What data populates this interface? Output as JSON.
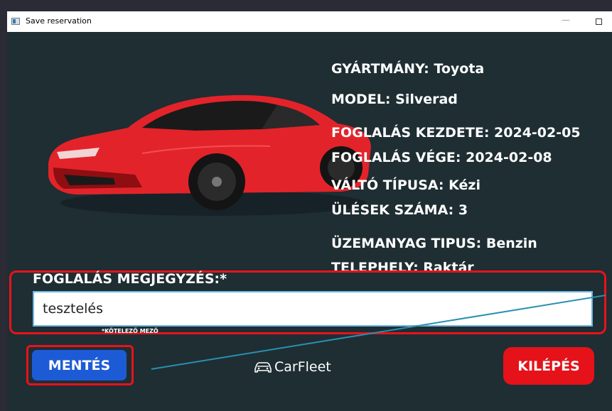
{
  "window": {
    "title": "Save reservation"
  },
  "car": {
    "image_alt": "red sports car",
    "colors": {
      "body": "#e3232a",
      "shadow": "#8e0e12",
      "glass": "#1a1a1a",
      "wheel": "#2b2b2b"
    }
  },
  "details": {
    "make": "GYÁRTMÁNY: Toyota",
    "model": "MODEL: Silverad",
    "start": "FOGLALÁS KEZDETE: 2024-02-05",
    "end": "FOGLALÁS VÉGE: 2024-02-08",
    "gearbox": "VÁLTÓ TÍPUSA: Kézi",
    "seats": "ÜLÉSEK SZÁMA: 3",
    "fuel": "ÜZEMANYAG TIPUS: Benzin",
    "site": "TELEPHELY: Raktár"
  },
  "note": {
    "label": "FOGLALÁS MEGJEGYZÉS:*",
    "value": "tesztelés",
    "required_hint": "*KÖTELEZŐ MEZŐ"
  },
  "actions": {
    "save_label": "MENTÉS",
    "exit_label": "KILÉPÉS"
  },
  "brand": {
    "name": "CarFleet"
  },
  "colors": {
    "background": "#1e2e33",
    "save": "#1d5bd6",
    "exit": "#e51219",
    "highlight": "#e8121b",
    "annotation_line": "#2a8fb0"
  }
}
